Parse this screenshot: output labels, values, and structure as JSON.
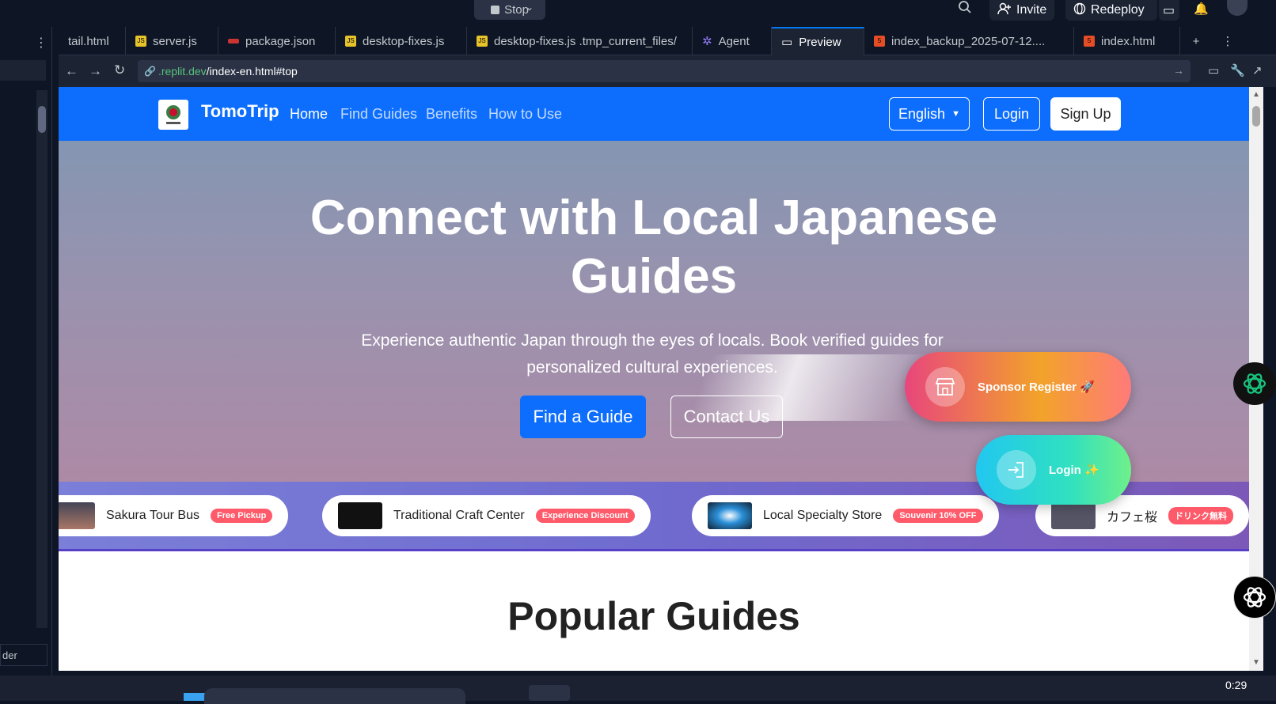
{
  "topbar": {
    "stop_label": "Stop",
    "invite_label": "Invite",
    "redeploy_label": "Redeploy"
  },
  "tabs": [
    {
      "label": "tail.html",
      "type": "html"
    },
    {
      "label": "server.js",
      "type": "js"
    },
    {
      "label": "package.json",
      "type": "json"
    },
    {
      "label": "desktop-fixes.js",
      "type": "js"
    },
    {
      "label": "desktop-fixes.js .tmp_current_files/",
      "type": "js"
    },
    {
      "label": "Agent",
      "type": "agent"
    },
    {
      "label": "Preview",
      "type": "preview",
      "active": true
    },
    {
      "label": "index_backup_2025-07-12....",
      "type": "html"
    },
    {
      "label": "index.html",
      "type": "html"
    }
  ],
  "address": {
    "host": ".replit.dev",
    "path": "/index-en.html#top"
  },
  "site": {
    "brand": "TomoTrip",
    "nav": [
      "Home",
      "Find Guides",
      "Benefits",
      "How to Use"
    ],
    "language": "English",
    "login": "Login",
    "signup": "Sign Up",
    "hero_title_line1": "Connect with Local Japanese",
    "hero_title_line2": "Guides",
    "hero_subtitle": "Experience authentic Japan through the eyes of locals. Book verified guides for personalized cultural experiences.",
    "find_guide": "Find a Guide",
    "contact": "Contact Us",
    "sponsors": [
      {
        "name": "Sakura Tour Bus",
        "badge": "Free Pickup"
      },
      {
        "name": "Traditional Craft Center",
        "badge": "Experience Discount"
      },
      {
        "name": "Local Specialty Store",
        "badge": "Souvenir 10% OFF"
      },
      {
        "name": "カフェ桜",
        "badge": "ドリンク無料"
      }
    ],
    "popular": "Popular Guides",
    "float_sponsor": "Sponsor Register 🚀",
    "float_login": "Login ✨"
  },
  "leftpanel": {
    "bottom_text": "der"
  },
  "taskbar": {
    "time": "0:29"
  },
  "colors": {
    "nav": "#0d6efd",
    "accent": "#0079f2"
  }
}
